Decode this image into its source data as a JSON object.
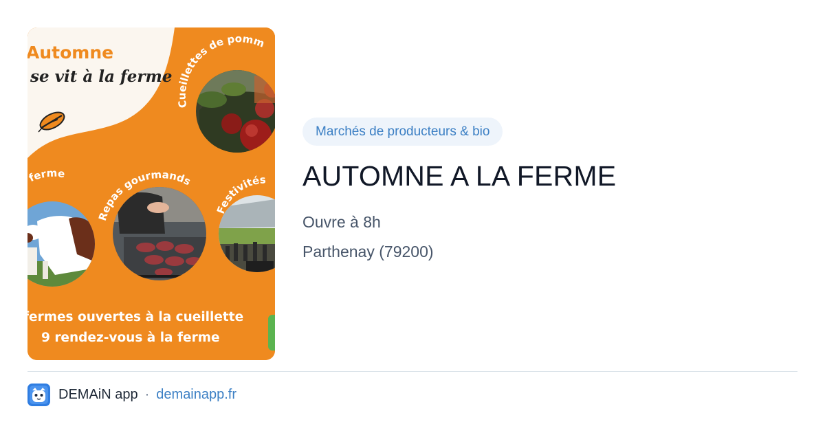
{
  "poster": {
    "title": "Automne",
    "subtitle": "se vit à la ferme",
    "arc_labels": {
      "apples": "Cueillettes de pomm",
      "farm": "la ferme",
      "meals": "Repas gourmands",
      "festivities": "Festivités"
    },
    "line1": "fermes ouvertes à la cueillette",
    "line2": "9 rendez-vous à la ferme"
  },
  "category_badge": "Marchés de producteurs & bio",
  "event_title": "AUTOMNE A LA FERME",
  "hours": "Ouvre à 8h",
  "location": "Parthenay (79200)",
  "footer": {
    "app_name": "DEMAiN app",
    "separator": "·",
    "domain": "demainapp.fr"
  },
  "colors": {
    "poster_orange": "#ef8a1f",
    "badge_bg": "#eef4fb",
    "link_blue": "#3b7fc4",
    "title_text": "#111827",
    "secondary_text": "#475569"
  }
}
